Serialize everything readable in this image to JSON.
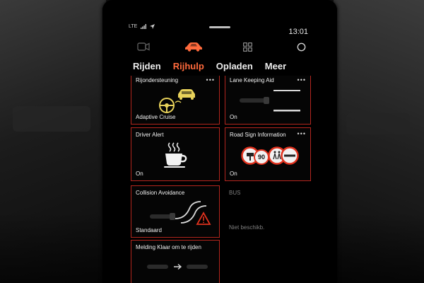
{
  "status_bar": {
    "network": "LTE",
    "time": "13:01"
  },
  "icons": {
    "camera": "video-camera-icon",
    "car": "car-icon",
    "apps": "apps-grid-icon",
    "profile": "profile-icon"
  },
  "tabs": [
    {
      "label": "Rijden",
      "active": false
    },
    {
      "label": "Rijhulp",
      "active": true
    },
    {
      "label": "Opladen",
      "active": false
    },
    {
      "label": "Meer",
      "active": false
    }
  ],
  "tiles": {
    "rijondersteuning": {
      "title": "Rijondersteuning",
      "status": "Adaptive Cruise"
    },
    "lane_keeping": {
      "title": "Lane Keeping Aid",
      "status": "On"
    },
    "driver_alert": {
      "title": "Driver Alert",
      "status": "On"
    },
    "road_sign": {
      "title": "Road Sign Information",
      "status": "On",
      "speed_limit": "90"
    },
    "collision": {
      "title": "Collision Avoidance",
      "status": "Standaard"
    },
    "melding": {
      "title": "Melding Klaar om te rijden"
    }
  },
  "bus": {
    "title": "BUS",
    "status": "Niet beschikb."
  },
  "colors": {
    "accent": "#ff6a3c",
    "tile_border": "#b3261e",
    "warning": "#e0321e",
    "driver_assist": "#e8d25a"
  }
}
